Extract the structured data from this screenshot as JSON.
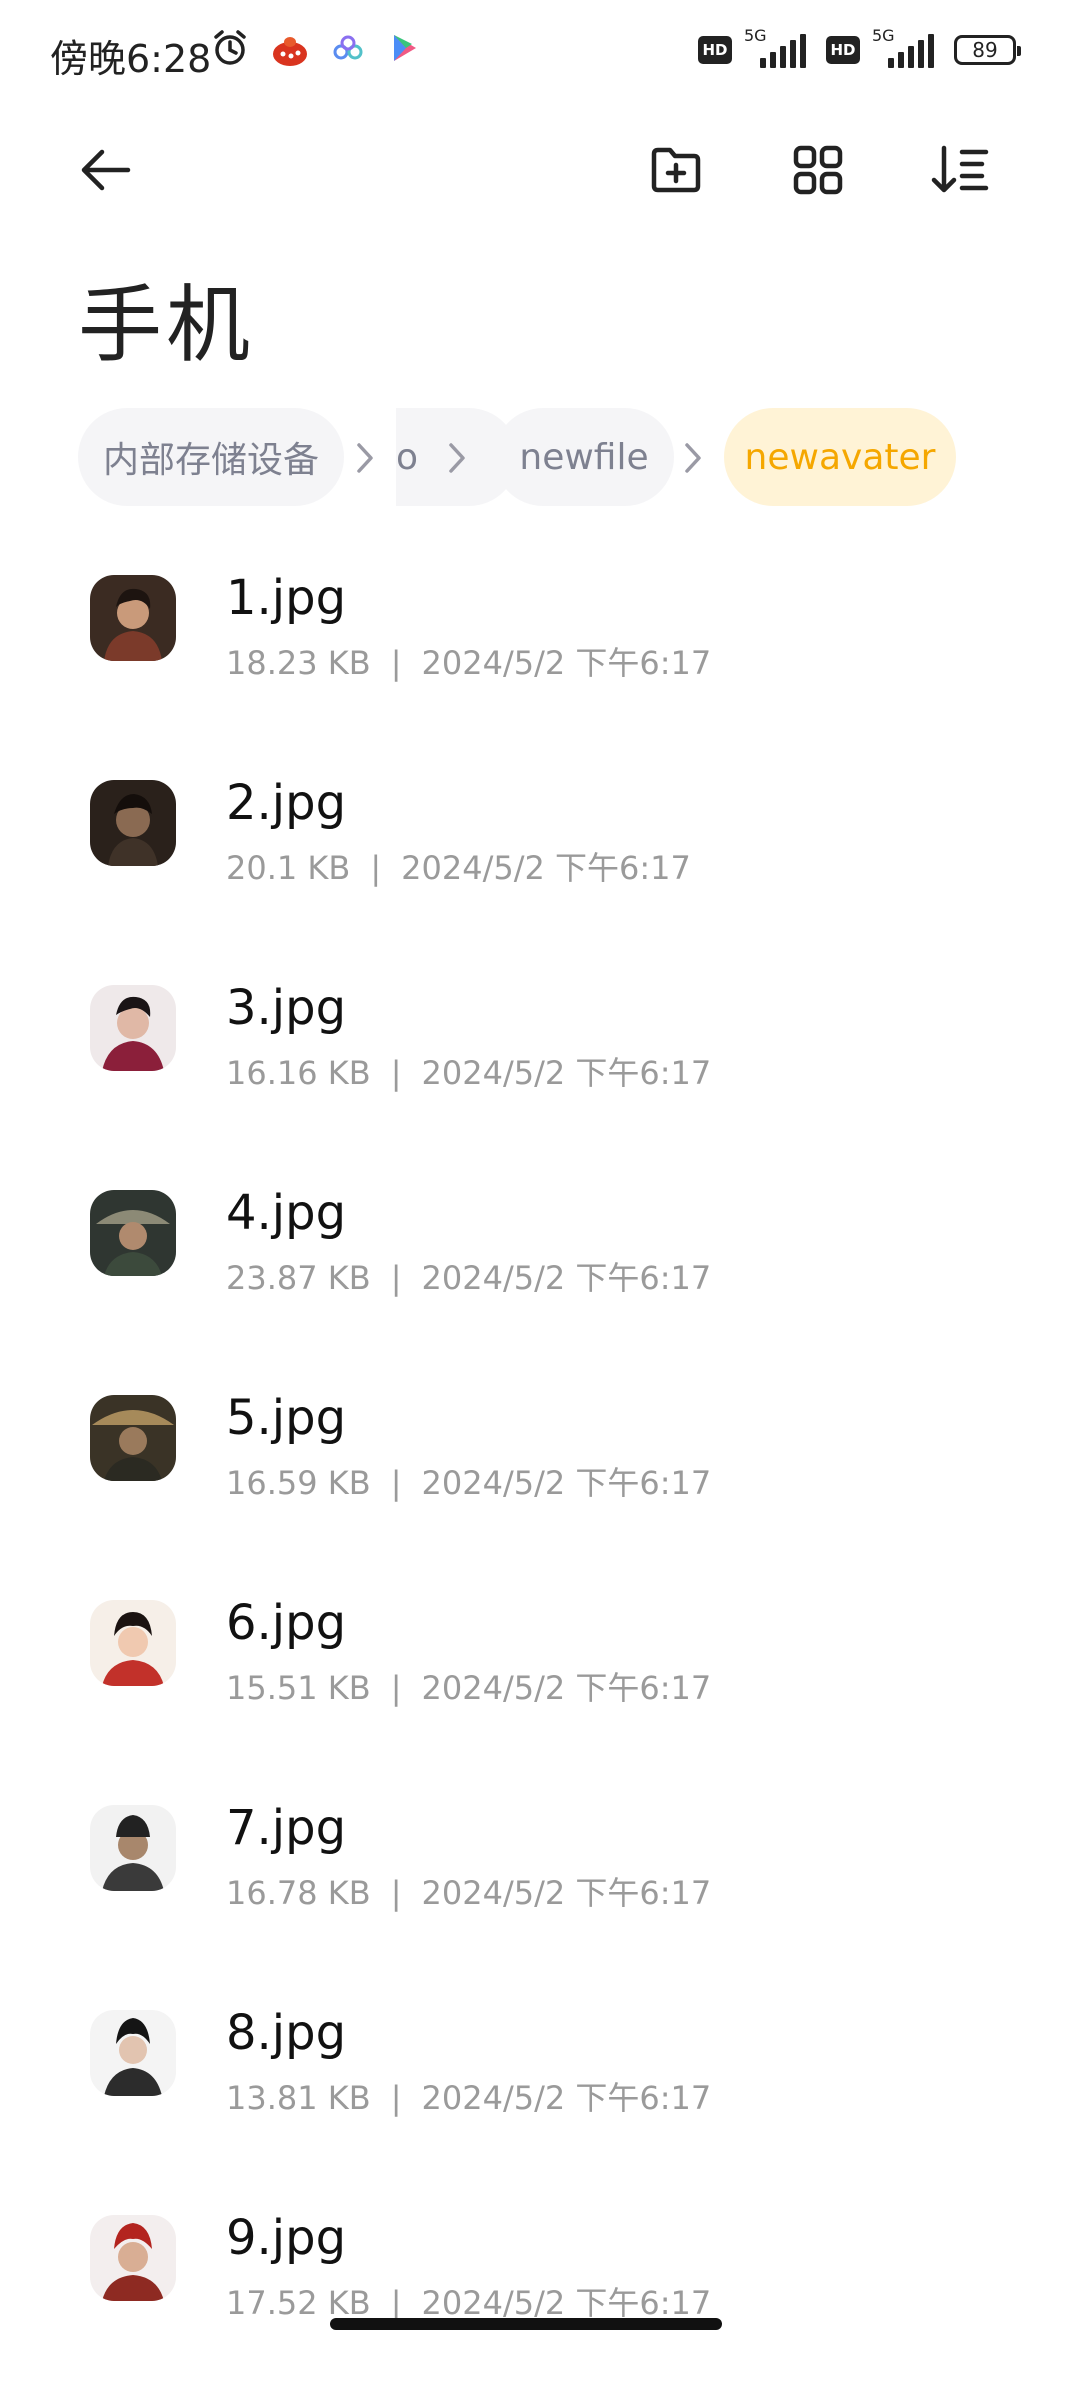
{
  "status_bar": {
    "time": "傍晚6:28",
    "left_icons": [
      "alarm-icon",
      "app-notification-icon",
      "cloud-app-icon",
      "play-store-icon"
    ],
    "network_label_1": "5G",
    "network_label_2": "5G",
    "hd_label": "HD",
    "battery": "89"
  },
  "toolbar": {
    "back_icon": "arrow-left-icon",
    "new_folder_icon": "folder-plus-icon",
    "grid_view_icon": "grid-view-icon",
    "sort_icon": "sort-icon"
  },
  "title": "手机",
  "breadcrumb": {
    "items": [
      {
        "label": "内部存储设备",
        "active": false
      },
      {
        "label": "o",
        "active": false
      },
      {
        "label": "newfile",
        "active": false
      },
      {
        "label": "newavater",
        "active": true
      }
    ],
    "separator_icon": "chevron-right-icon"
  },
  "files": [
    {
      "name": "1.jpg",
      "size": "18.23 KB",
      "date": "2024/5/2 下午6:17"
    },
    {
      "name": "2.jpg",
      "size": "20.1 KB",
      "date": "2024/5/2 下午6:17"
    },
    {
      "name": "3.jpg",
      "size": "16.16 KB",
      "date": "2024/5/2 下午6:17"
    },
    {
      "name": "4.jpg",
      "size": "23.87 KB",
      "date": "2024/5/2 下午6:17"
    },
    {
      "name": "5.jpg",
      "size": "16.59 KB",
      "date": "2024/5/2 下午6:17"
    },
    {
      "name": "6.jpg",
      "size": "15.51 KB",
      "date": "2024/5/2 下午6:17"
    },
    {
      "name": "7.jpg",
      "size": "16.78 KB",
      "date": "2024/5/2 下午6:17"
    },
    {
      "name": "8.jpg",
      "size": "13.81 KB",
      "date": "2024/5/2 下午6:17"
    },
    {
      "name": "9.jpg",
      "size": "17.52 KB",
      "date": "2024/5/2 下午6:17"
    }
  ],
  "meta_separator": "|",
  "colors": {
    "accent": "#f5a700",
    "accent_bg": "#fff3d6",
    "chip_bg": "#f5f5f7",
    "meta_text": "#9a9a9a"
  }
}
